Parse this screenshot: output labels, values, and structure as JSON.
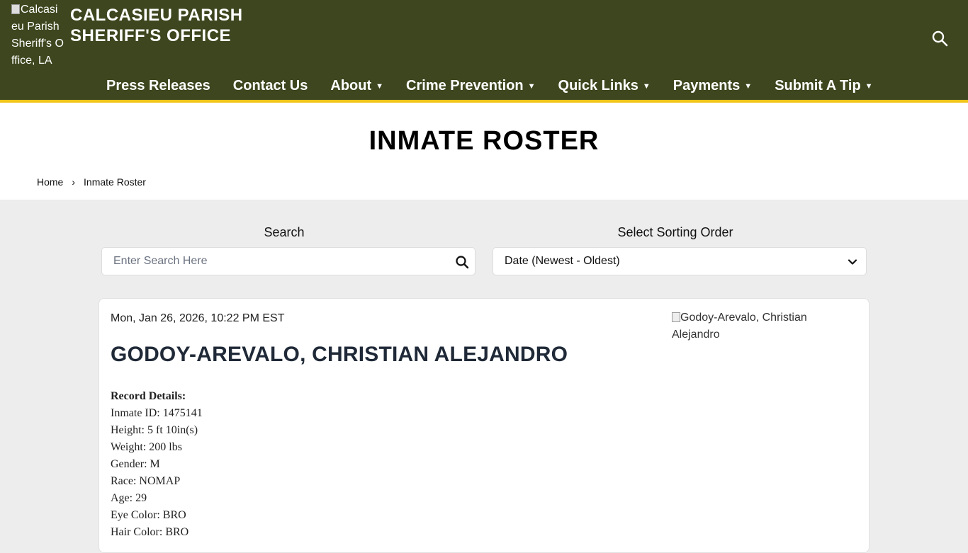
{
  "header": {
    "logo_alt": "Calcasieu Parish Sheriff's Office, LA",
    "site_title": "CALCASIEU PARISH SHERIFF'S OFFICE",
    "nav": [
      {
        "label": "Press Releases",
        "dropdown": false
      },
      {
        "label": "Contact Us",
        "dropdown": false
      },
      {
        "label": "About",
        "dropdown": true
      },
      {
        "label": "Crime Prevention",
        "dropdown": true
      },
      {
        "label": "Quick Links",
        "dropdown": true
      },
      {
        "label": "Payments",
        "dropdown": true
      },
      {
        "label": "Submit A Tip",
        "dropdown": true
      }
    ]
  },
  "page": {
    "title": "INMATE ROSTER",
    "breadcrumb": {
      "home": "Home",
      "separator": "›",
      "current": "Inmate Roster"
    }
  },
  "filters": {
    "search_label": "Search",
    "search_placeholder": "Enter Search Here",
    "search_value": "",
    "sort_label": "Select Sorting Order",
    "sort_value": "Date (Newest - Oldest)"
  },
  "record": {
    "date": "Mon, Jan 26, 2026, 10:22 PM EST",
    "name": "GODOY-AREVALO, CHRISTIAN ALEJANDRO",
    "photo_alt": "Godoy-Arevalo, Christian Alejandro",
    "details_heading": "Record Details:",
    "details": [
      "Inmate ID: 1475141",
      "Height: 5 ft 10in(s)",
      "Weight: 200 lbs",
      "Gender: M",
      "Race: NOMAP",
      "Age: 29",
      "Eye Color: BRO",
      "Hair Color: BRO"
    ]
  },
  "colors": {
    "header_bg": "#3d461e",
    "header_accent": "#f0c419",
    "page_bg": "#ededed"
  }
}
